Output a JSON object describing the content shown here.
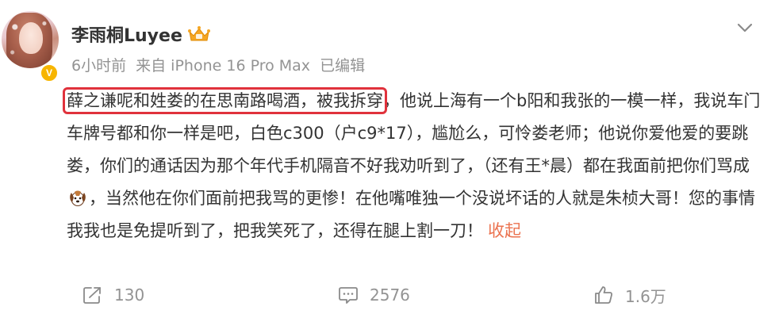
{
  "user": {
    "name": "李雨桐Luyee",
    "verified_badge": "V"
  },
  "meta": {
    "time": "6小时前",
    "source": "来自 iPhone 16 Pro Max",
    "edited": "已编辑"
  },
  "post": {
    "highlighted": "薛之谦呢和姓娄的在思南路喝酒，被我拆穿",
    "text_1": "，他说上海有一个b阳和我张的一模一样，我说车门车牌号都和你一样是吧，白色c300（户c9*17），尴尬么，可怜娄老师；他说你爱他爱的要跳娄，你们的通话因为那个年代手机隔音不好我劝听到了，（还有王*晨）都在我面前把你们骂成",
    "emoji": "dog-emoji",
    "text_2": "，当然他在你们面前把我骂的更惨！在他嘴唯独一个没说坏话的人就是朱桢大哥！您的事情我我也是免提听到了，把我笑死了，还得在腿上割一刀！",
    "collapse_label": "收起"
  },
  "actions": {
    "share_count": "130",
    "comment_count": "2576",
    "like_count": "1.6万"
  },
  "icons": {
    "share": "share-icon",
    "comment": "comment-icon",
    "like": "thumbs-up-icon",
    "menu": "chevron-down-icon",
    "vip": "vip-crown-icon"
  },
  "colors": {
    "highlight_border": "#e0323c",
    "collapse_link": "#eb7350",
    "badge": "#f7b500",
    "meta_text": "#939393"
  }
}
